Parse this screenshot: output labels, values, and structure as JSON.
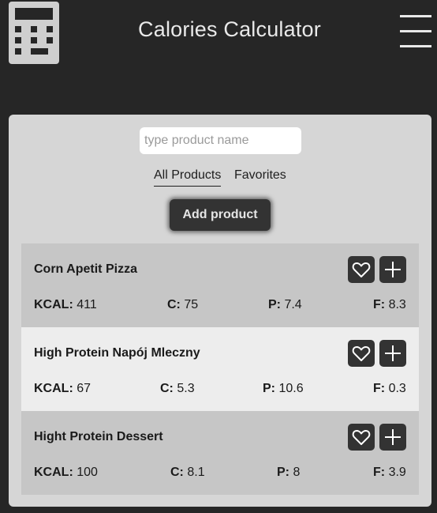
{
  "header": {
    "title": "Calories Calculator",
    "logo_icon": "calculator-icon",
    "menu_icon": "hamburger-menu-icon"
  },
  "search": {
    "placeholder": "type product name",
    "value": ""
  },
  "tabs": [
    {
      "label": "All Products",
      "active": true
    },
    {
      "label": "Favorites",
      "active": false
    }
  ],
  "add_button": {
    "label": "Add product"
  },
  "nutrient_labels": {
    "kcal": "KCAL:",
    "carbs": "C:",
    "protein": "P:",
    "fat": "F:"
  },
  "products": [
    {
      "name": "Corn Apetit Pizza",
      "kcal": "411",
      "carbs": "75",
      "protein": "7.4",
      "fat": "8.3"
    },
    {
      "name": "High Protein Napój Mleczny",
      "kcal": "67",
      "carbs": "5.3",
      "protein": "10.6",
      "fat": "0.3"
    },
    {
      "name": "Hight Protein Dessert",
      "kcal": "100",
      "carbs": "8.1",
      "protein": "8",
      "fat": "3.9"
    }
  ],
  "colors": {
    "background": "#262626",
    "panel": "#d6d6d6",
    "button": "#333333",
    "row_dark": "#c6c6c6",
    "row_light": "#ededed"
  }
}
